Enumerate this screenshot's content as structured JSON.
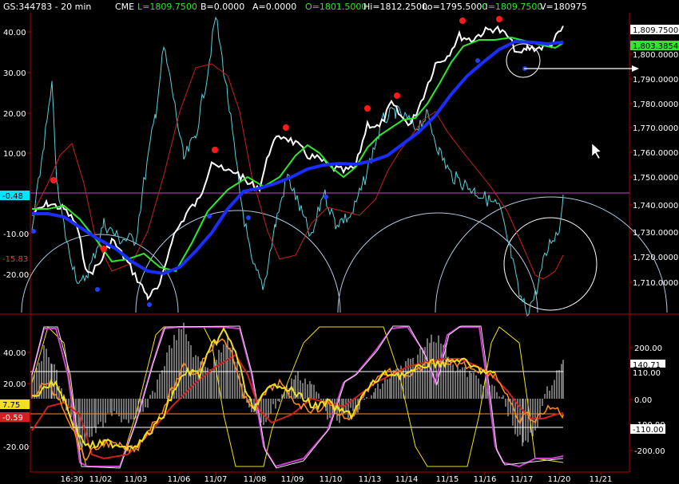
{
  "header": {
    "symbol": "GS:344783 - 20 min",
    "exchange": "CME",
    "last": "L=1809.7500",
    "bid": "B=0.0000",
    "ask": "A=0.0000",
    "open": "O=1801.5000",
    "high": "Hi=1812.2500",
    "low": "Lo=1795.5000",
    "close": "C=1809.7500",
    "volume": "V=180975"
  },
  "colors": {
    "background": "#000000",
    "price": "#ffffff",
    "cyan_osc": "#5ad0d8",
    "red_avg": "#c8201a",
    "green_avg": "#2ee82e",
    "blue_avg": "#1a2eff",
    "magenta_line": "#d040d0",
    "circle": "#b0c8e0",
    "yellow": "#f0e020",
    "orange": "#ff8a20",
    "histogram": "#c8c8c8"
  },
  "upper_panel": {
    "left_axis_ticks": [
      "40.00",
      "30.00",
      "20.00",
      "10.00",
      "-10.00",
      "-20.00"
    ],
    "right_axis_ticks": [
      "1,800.0000",
      "1,790.0000",
      "1,780.0000",
      "1,770.0000",
      "1,760.0000",
      "1,750.0000",
      "1,740.0000",
      "1,730.0000",
      "1,720.0000",
      "1,710.0000"
    ],
    "left_badges": [
      {
        "text": "-0.48",
        "bg": "#00e5ff",
        "fg": "#000000"
      },
      {
        "text": "-15.83",
        "bg": "#000000",
        "fg": "#ff3030"
      }
    ],
    "right_badges": [
      {
        "text": "1,809.7500",
        "bg": "#ffffff",
        "fg": "#000000"
      },
      {
        "text": "1,803.3854",
        "bg": "#2ee82e",
        "fg": "#000000"
      }
    ]
  },
  "lower_panel": {
    "left_axis_ticks": [
      "40.00",
      "20.00",
      "-20.00"
    ],
    "right_axis_ticks": [
      "200.00",
      "100.00",
      "0.00",
      "-100.00",
      "-200.00"
    ],
    "left_badges": [
      {
        "text": "7.75",
        "bg": "#f0e020",
        "fg": "#000000"
      },
      {
        "text": "-0.59",
        "bg": "#d02020",
        "fg": "#ffffff"
      }
    ],
    "right_badges": [
      {
        "text": "140.71",
        "bg": "#ffffff",
        "fg": "#000000"
      },
      {
        "text": "110.00",
        "bg": "#000000",
        "fg": "#ffffff"
      },
      {
        "text": "-110.00",
        "bg": "#ffffff",
        "fg": "#000000"
      }
    ]
  },
  "x_axis_labels": [
    "16:30",
    "11/02",
    "11/03",
    "11/06",
    "11/07",
    "11/08",
    "11/09",
    "11/10",
    "11/13",
    "11/14",
    "11/15",
    "11/16",
    "11/17",
    "11/20",
    "11/21"
  ]
}
